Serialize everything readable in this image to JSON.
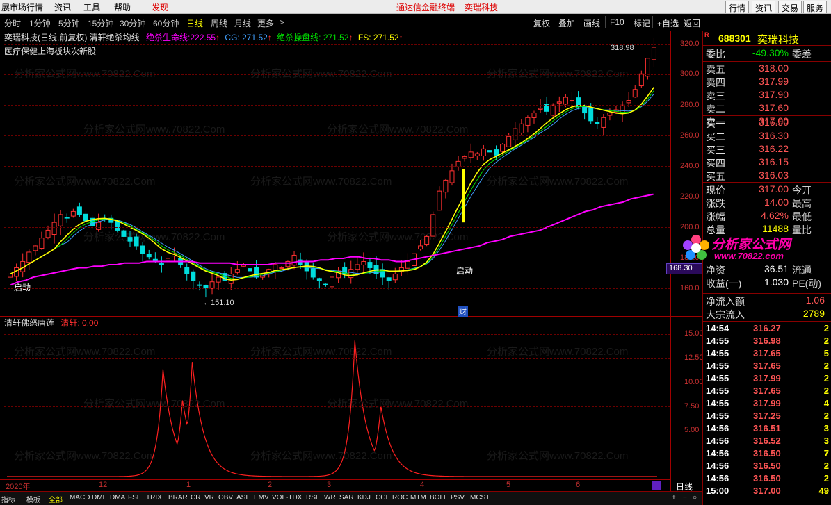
{
  "menu": {
    "items": [
      "展市场行情",
      "资讯",
      "工具",
      "帮助"
    ],
    "discover": "发现",
    "center1": "通达信金融终端",
    "center2": "奕瑞科技",
    "right": [
      "行情",
      "资讯",
      "交易",
      "服务"
    ]
  },
  "toolbar": {
    "periods": [
      "分时",
      "1分钟",
      "5分钟",
      "15分钟",
      "30分钟",
      "60分钟",
      "日线",
      "周线",
      "月线",
      "更多",
      ">"
    ],
    "selected": "日线",
    "buttons": [
      "复权",
      "叠加",
      "画线",
      "F10",
      "标记",
      "+自选",
      "返回"
    ]
  },
  "indicator_line": {
    "name": "奕瑞科技(日线,前复权) 清轩绝杀均线",
    "l1_label": "绝杀生命线:",
    "l1_value": "222.55",
    "l2_label": "CG:",
    "l2_value": "271.52",
    "l3_label": "绝杀操盘线:",
    "l3_value": "271.52",
    "l4_label": "FS:",
    "l4_value": "271.52",
    "sector": "医疗保健上海板块次新股",
    "colors": {
      "life": "#ff00ff",
      "cg": "#40a0ff",
      "op": "#00e000",
      "fs": "#ffff00"
    }
  },
  "main_chart": {
    "price_axis": [
      "320.0",
      "300.0",
      "280.0",
      "260.0",
      "240.0",
      "220.0",
      "200.0",
      "180.0",
      "160.0"
    ],
    "high_label": "318.98",
    "low_label": "←151.10",
    "start1": "启动",
    "start2": "启动",
    "cai": "财",
    "current_price_tag": "168.30"
  },
  "sub_chart": {
    "name": "清轩佛怒唐莲",
    "value_label": "清轩: 0.00",
    "axis": [
      "15.00",
      "12.50",
      "10.00",
      "7.50",
      "5.00"
    ]
  },
  "time_axis": [
    "2020年",
    "12",
    "1",
    "2",
    "3",
    "4",
    "5",
    "6"
  ],
  "period_tag": "日线",
  "bottom_tabs": [
    "指标",
    "模板",
    "全部",
    "MACD",
    "DMI",
    "DMA",
    "FSL",
    "TRIX",
    "BRAR",
    "CR",
    "VR",
    "OBV",
    "ASI",
    "EMV",
    "VOL-TDX",
    "RSI",
    "WR",
    "SAR",
    "KDJ",
    "CCI",
    "ROC",
    "MTM",
    "BOLL",
    "PSV",
    "MCST"
  ],
  "bottom_right": [
    "+",
    "−",
    "○"
  ],
  "stock": {
    "code": "688301",
    "name": "奕瑞科技",
    "flag": "R"
  },
  "quote": {
    "webi_label": "委比",
    "webi_value": "-49.30%",
    "weicha_label": "委差",
    "asks": [
      [
        "卖五",
        "318.00"
      ],
      [
        "卖四",
        "317.99"
      ],
      [
        "卖三",
        "317.90"
      ],
      [
        "卖二",
        "317.60"
      ],
      [
        "卖一",
        "317.00"
      ]
    ],
    "bids": [
      [
        "买一",
        "316.50"
      ],
      [
        "买二",
        "316.30"
      ],
      [
        "买三",
        "316.22"
      ],
      [
        "买四",
        "316.15"
      ],
      [
        "买五",
        "316.03"
      ]
    ],
    "stats": [
      [
        "现价",
        "317.00",
        "今开"
      ],
      [
        "涨跌",
        "14.00",
        "最高"
      ],
      [
        "涨幅",
        "4.62%",
        "最低"
      ],
      [
        "总量",
        "11488",
        "量比"
      ],
      [
        "净资",
        "36.51",
        "流通"
      ],
      [
        "收益(一)",
        "1.030",
        "PE(动)"
      ]
    ],
    "netflow_label": "净流入额",
    "netflow_value": "1.06",
    "block_label": "大宗流入",
    "block_value": "2789"
  },
  "ticks": [
    [
      "14:54",
      "316.27",
      "2"
    ],
    [
      "14:55",
      "316.98",
      "2"
    ],
    [
      "14:55",
      "317.65",
      "5"
    ],
    [
      "14:55",
      "317.65",
      "2"
    ],
    [
      "14:55",
      "317.99",
      "2"
    ],
    [
      "14:55",
      "317.65",
      "2"
    ],
    [
      "14:55",
      "317.99",
      "4"
    ],
    [
      "14:55",
      "317.25",
      "2"
    ],
    [
      "14:56",
      "316.51",
      "3"
    ],
    [
      "14:56",
      "316.52",
      "3"
    ],
    [
      "14:56",
      "316.50",
      "7"
    ],
    [
      "14:56",
      "316.50",
      "2"
    ],
    [
      "14:56",
      "316.50",
      "2"
    ],
    [
      "15:00",
      "317.00",
      "49"
    ]
  ],
  "ad": {
    "brand": "分析家公式网",
    "url": "www.70822.com"
  },
  "watermark": "分析家公式网www.70822.Com",
  "chart_data": {
    "type": "candlestick",
    "note_series": [
      "绝杀生命线",
      "CG",
      "绝杀操盘线",
      "FS"
    ],
    "ylim": [
      150,
      325
    ],
    "closes": [
      172,
      176,
      180,
      186,
      190,
      195,
      200,
      205,
      210,
      208,
      212,
      210,
      206,
      203,
      205,
      207,
      205,
      200,
      196,
      193,
      190,
      185,
      183,
      180,
      178,
      182,
      185,
      178,
      172,
      168,
      165,
      163,
      167,
      170,
      168,
      172,
      175,
      178,
      174,
      170,
      172,
      175,
      178,
      176,
      180,
      184,
      178,
      174,
      170,
      168,
      165,
      170,
      174,
      172,
      175,
      178,
      180,
      176,
      172,
      170,
      168,
      172,
      176,
      180,
      185,
      190,
      196,
      210,
      225,
      232,
      238,
      244,
      247,
      250,
      249,
      252,
      250,
      248,
      255,
      260,
      265,
      268,
      272,
      275,
      278,
      276,
      280,
      282,
      285,
      283,
      279,
      275,
      270,
      268,
      272,
      275,
      277,
      280,
      283,
      290,
      300,
      310,
      317
    ],
    "life_line": [
      165,
      167,
      168,
      170,
      171,
      172,
      173,
      174,
      175,
      176,
      176,
      177,
      177,
      178,
      178,
      179,
      179,
      179,
      180,
      180,
      180,
      180,
      180,
      180,
      180,
      179,
      179,
      179,
      179,
      179,
      178,
      178,
      178,
      178,
      178,
      179,
      179,
      179,
      180,
      180,
      180,
      181,
      181,
      182,
      182,
      183,
      183,
      182,
      182,
      181,
      181,
      180,
      180,
      181,
      182,
      183,
      184,
      185,
      186,
      187,
      188,
      189,
      190,
      192,
      193,
      194,
      196,
      197,
      198,
      199,
      200,
      202,
      204,
      206,
      208,
      210,
      212,
      213,
      215,
      216,
      217,
      218,
      220,
      221,
      222,
      223
    ]
  },
  "sub_data": {
    "type": "line",
    "ylim": [
      0,
      16
    ],
    "peaks": [
      [
        0.24,
        12
      ],
      [
        0.27,
        8.5
      ],
      [
        0.285,
        12.8
      ],
      [
        0.535,
        15.2
      ],
      [
        0.575,
        7.9
      ]
    ]
  }
}
